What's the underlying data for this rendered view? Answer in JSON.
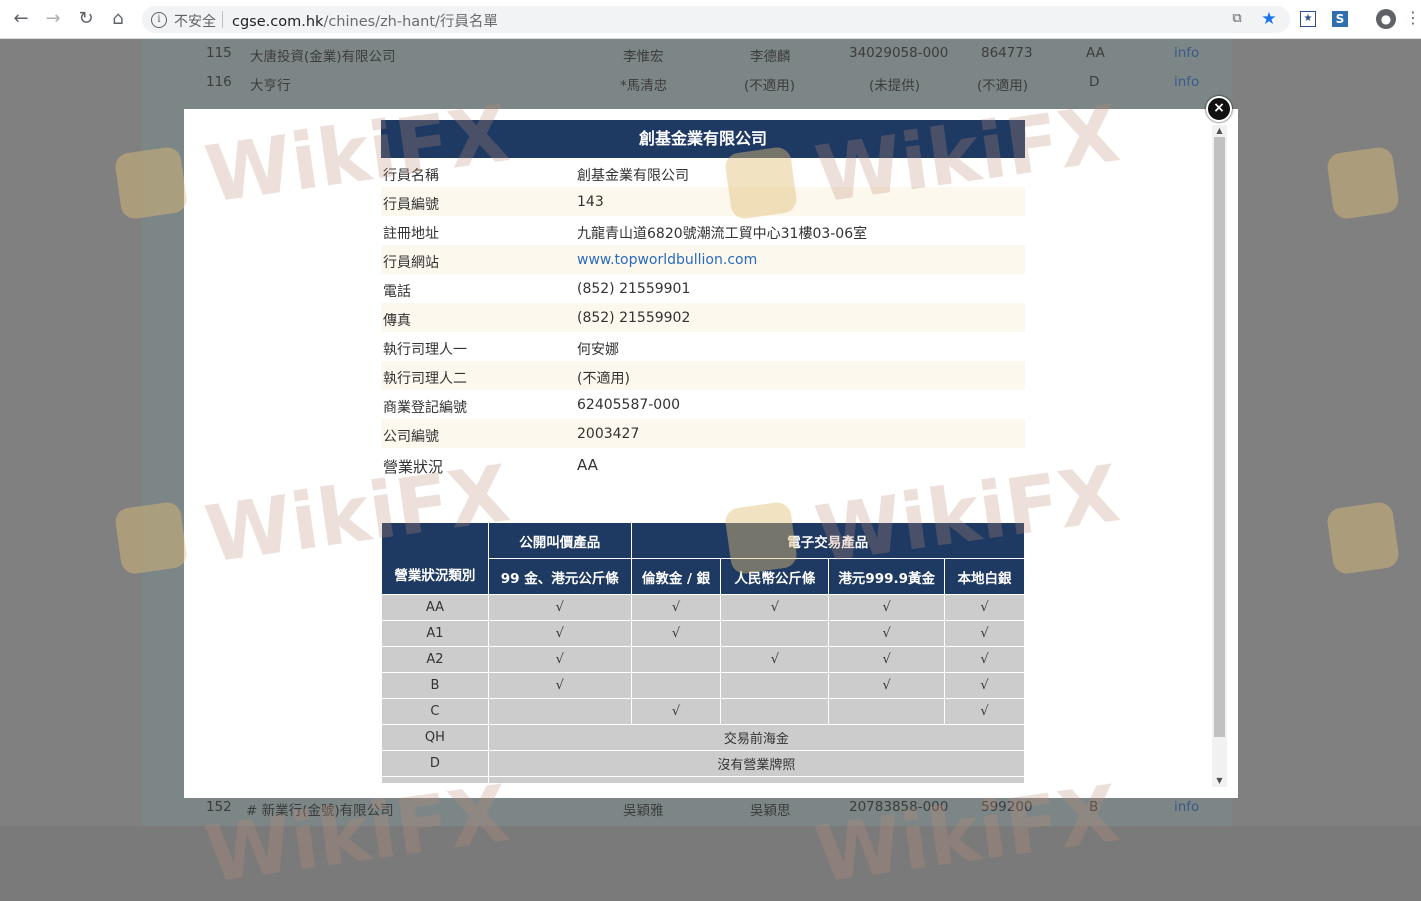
{
  "browser": {
    "security_label": "不安全",
    "url_domain": "cgse.com.hk",
    "url_path": "/chines/zh-hant/行員名單"
  },
  "background_table": {
    "rows": [
      {
        "no": "115",
        "name": "大唐投資(金業)有限公司",
        "p1": "李惟宏",
        "p2": "李德麟",
        "reg": "34029058-000",
        "code": "864773",
        "status": "AA",
        "link": "info"
      },
      {
        "no": "116",
        "name": "大亨行",
        "p1": "*馬清忠",
        "p2": "(不適用)",
        "reg": "(未提供)",
        "code": "(不適用)",
        "status": "D",
        "link": "info"
      },
      {
        "no": "152",
        "name": "# 新業行(金號)有限公司",
        "p1": "吳穎雅",
        "p2": "吳穎思",
        "reg": "20783858-000",
        "code": "599200",
        "status": "B",
        "link": "info"
      }
    ]
  },
  "modal": {
    "title": "創基金業有限公司",
    "close_symbol": "×",
    "fields": [
      {
        "label": "行員名稱",
        "value": "創基金業有限公司",
        "link": false
      },
      {
        "label": "行員編號",
        "value": "143",
        "link": false
      },
      {
        "label": "註冊地址",
        "value": "九龍青山道6820號潮流工貿中心31樓03-06室",
        "link": false
      },
      {
        "label": "行員網站",
        "value": "www.topworldbullion.com",
        "link": true
      },
      {
        "label": "電話",
        "value": "(852) 21559901",
        "link": false
      },
      {
        "label": "傳真",
        "value": "(852) 21559902",
        "link": false
      },
      {
        "label": "執行司理人一",
        "value": "何安娜",
        "link": false
      },
      {
        "label": "執行司理人二",
        "value": "(不適用)",
        "link": false
      },
      {
        "label": "商業登記編號",
        "value": "62405587-000",
        "link": false
      },
      {
        "label": "公司編號",
        "value": "2003427",
        "link": false
      },
      {
        "label": "營業狀況",
        "value": "AA",
        "link": false
      }
    ],
    "grid": {
      "header_category": "營業狀況類別",
      "group_public": "公開叫價產品",
      "group_electronic": "電子交易產品",
      "columns": [
        "99 金、港元公斤條",
        "倫敦金 / 銀",
        "人民幣公斤條",
        "港元999.9黃金",
        "本地白銀"
      ],
      "rows": [
        {
          "cat": "AA",
          "cells": [
            "√",
            "√",
            "√",
            "√",
            "√"
          ]
        },
        {
          "cat": "A1",
          "cells": [
            "√",
            "√",
            "",
            "√",
            "√"
          ]
        },
        {
          "cat": "A2",
          "cells": [
            "√",
            "",
            "√",
            "√",
            "√"
          ]
        },
        {
          "cat": "B",
          "cells": [
            "√",
            "",
            "",
            "√",
            "√"
          ]
        },
        {
          "cat": "C",
          "cells": [
            "",
            "√",
            "",
            "",
            "√"
          ]
        }
      ],
      "span_rows": [
        {
          "cat": "QH",
          "text": "交易前海金"
        },
        {
          "cat": "D",
          "text": "沒有營業牌照"
        }
      ]
    }
  },
  "watermark_text": "WikiFX"
}
